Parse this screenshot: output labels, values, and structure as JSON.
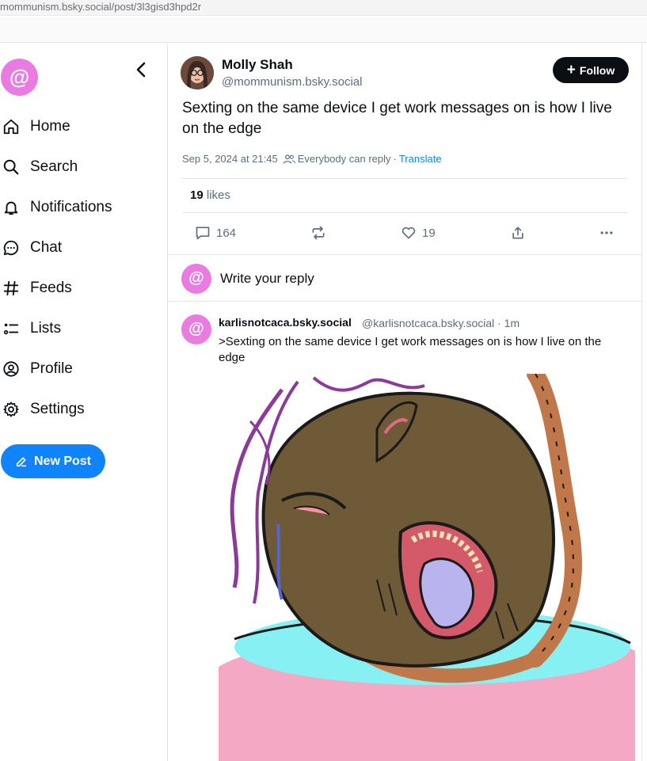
{
  "browser": {
    "url": "mommunism.bsky.social/post/3l3gisd3hpd2r"
  },
  "app": {
    "logo_glyph": "@",
    "accent_color": "#1083fe",
    "logo_color": "#ea7be0"
  },
  "sidebar": {
    "items": [
      {
        "label": "Home",
        "icon": "home-icon"
      },
      {
        "label": "Search",
        "icon": "search-icon"
      },
      {
        "label": "Notifications",
        "icon": "bell-icon"
      },
      {
        "label": "Chat",
        "icon": "chat-icon"
      },
      {
        "label": "Feeds",
        "icon": "hash-icon"
      },
      {
        "label": "Lists",
        "icon": "list-icon"
      },
      {
        "label": "Profile",
        "icon": "profile-icon"
      },
      {
        "label": "Settings",
        "icon": "gear-icon"
      }
    ],
    "new_post_label": "New Post"
  },
  "post": {
    "author_name": "Molly Shah",
    "author_handle": "@mommunism.bsky.social",
    "follow_label": "Follow",
    "text": "Sexting on the same device I get work messages on is how I live on the edge",
    "date": "Sep 5, 2024 at 21:45",
    "reply_setting": "Everybody can reply",
    "separator": "·",
    "translate_label": "Translate",
    "likes_count": "19",
    "likes_label": "likes",
    "actions": {
      "reply_count": "164",
      "like_count": "19"
    }
  },
  "reply_composer": {
    "avatar_glyph": "@",
    "placeholder": "Write your reply"
  },
  "replies": [
    {
      "avatar_glyph": "@",
      "name": "karlisnotcaca.bsky.social",
      "handle": "@karlisnotcaca.bsky.social",
      "time": "· 1m",
      "text": ">Sexting on the same device I get work messages on is how I live on the edge"
    }
  ]
}
